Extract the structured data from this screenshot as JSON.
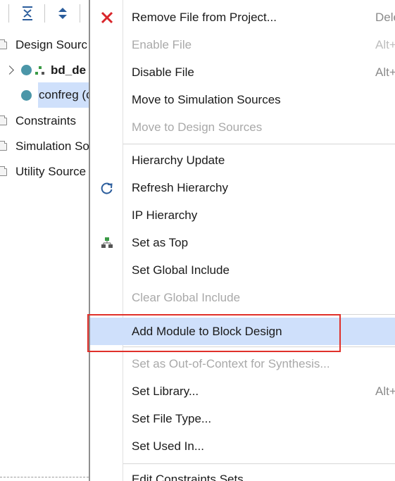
{
  "left_panel": {
    "tree": [
      {
        "label": "Design Sourc",
        "kind": "folder"
      },
      {
        "label": "bd_de",
        "kind": "block-design"
      },
      {
        "label": "confreg (c",
        "kind": "file",
        "selected": true
      },
      {
        "label": "Constraints",
        "kind": "folder"
      },
      {
        "label": "Simulation So",
        "kind": "folder"
      },
      {
        "label": "Utility Source",
        "kind": "folder"
      }
    ]
  },
  "menu": {
    "items": [
      {
        "label": "Remove File from Project...",
        "shortcut": "Dele",
        "icon": "close-icon",
        "enabled": true
      },
      {
        "label": "Enable File",
        "shortcut": "Alt+",
        "enabled": false
      },
      {
        "label": "Disable File",
        "shortcut": "Alt+",
        "enabled": true
      },
      {
        "label": "Move to Simulation Sources",
        "enabled": true
      },
      {
        "label": "Move to Design Sources",
        "enabled": false
      },
      {
        "label": "Hierarchy Update",
        "enabled": true
      },
      {
        "label": "Refresh Hierarchy",
        "icon": "refresh-icon",
        "enabled": true
      },
      {
        "label": "IP Hierarchy",
        "enabled": true
      },
      {
        "label": "Set as Top",
        "icon": "hierarchy-icon",
        "enabled": true
      },
      {
        "label": "Set Global Include",
        "enabled": true
      },
      {
        "label": "Clear Global Include",
        "enabled": false
      },
      {
        "label": "Add Module to Block Design",
        "enabled": true,
        "highlighted": true
      },
      {
        "label": "Set as Out-of-Context for Synthesis...",
        "enabled": false
      },
      {
        "label": "Set Library...",
        "shortcut": "Alt+",
        "enabled": true
      },
      {
        "label": "Set File Type...",
        "enabled": true
      },
      {
        "label": "Set Used In...",
        "enabled": true
      },
      {
        "label": "Edit Constraints Sets",
        "enabled": true
      }
    ]
  },
  "colors": {
    "highlight": "#cfe0fb",
    "annotation_box": "#e0302a",
    "remove_icon": "#d9252a",
    "tree_dot": "#4b96a8",
    "hierarchy_icon": "#3a9a45"
  }
}
